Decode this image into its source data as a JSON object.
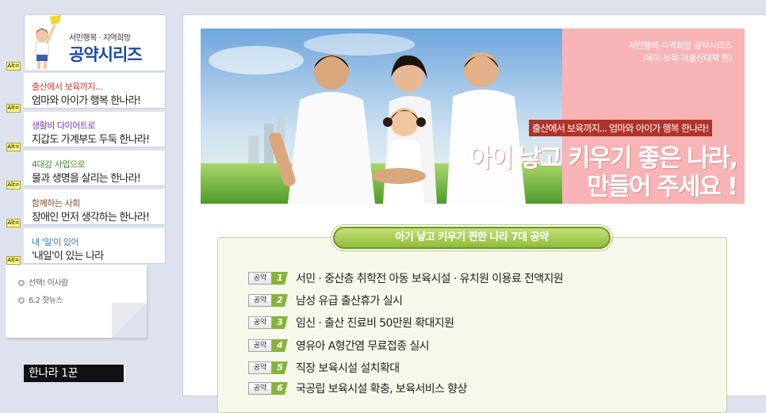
{
  "sidebar": {
    "logo": {
      "subtitle": "서민행복 · 지역희망",
      "title": "공약시리즈"
    },
    "alt_label": "Alt=",
    "items": [
      {
        "kicker": "출산에서 보육까지...",
        "kicker_color": "#d2372c",
        "title": "엄마와 아이가 행복 한나라!"
      },
      {
        "kicker": "생활비 다이어트로",
        "kicker_color": "#7a35b0",
        "title": "지갑도 가계부도 두둑 한나라!"
      },
      {
        "kicker": "4대강 사업으로",
        "kicker_color": "#3d8a2c",
        "title": "물과 생명을 살리는 한나라!"
      },
      {
        "kicker": "함께하는 사회",
        "kicker_color": "#8a4a2a",
        "title": "장애인 먼저 생각하는 한나라!"
      },
      {
        "kicker": "내 '일'이 있어",
        "kicker_color": "#2a7ab8",
        "title": "'내일'이 있는 나라"
      }
    ],
    "note_links": [
      "선택! 이사람",
      "6.2 핫뉴스"
    ],
    "book_label": "한나라 1꾼"
  },
  "banner": {
    "series_line1": "서민행복·지역희망 공약시리즈",
    "series_line2": "(육아·보육·저출산대책 편)",
    "tagline": "출산에서 보육까지... 엄마와 아이가 행복 한나라!",
    "headline1": "아이 낳고 키우기 좋은 나라,",
    "headline2": "만들어 주세요 !"
  },
  "pledges": {
    "title": "아기 낳고 키우기 편한 나라 7대 공약",
    "label": "공약",
    "items": [
      {
        "num": "1",
        "text": "서민 · 중산층 취학전 아동 보육시설 · 유치원 이용료 전액지원"
      },
      {
        "num": "2",
        "text": "남성 유급 출산휴가 실시"
      },
      {
        "num": "3",
        "text": "임신 · 출산 진료비 50만원 확대지원"
      },
      {
        "num": "4",
        "text": "영유아 A형간염 무료접종 실시"
      },
      {
        "num": "5",
        "text": "직장 보육시설 설치확대"
      },
      {
        "num": "6",
        "text": "국공립 보육시설 확충, 보육서비스 향상"
      }
    ]
  }
}
